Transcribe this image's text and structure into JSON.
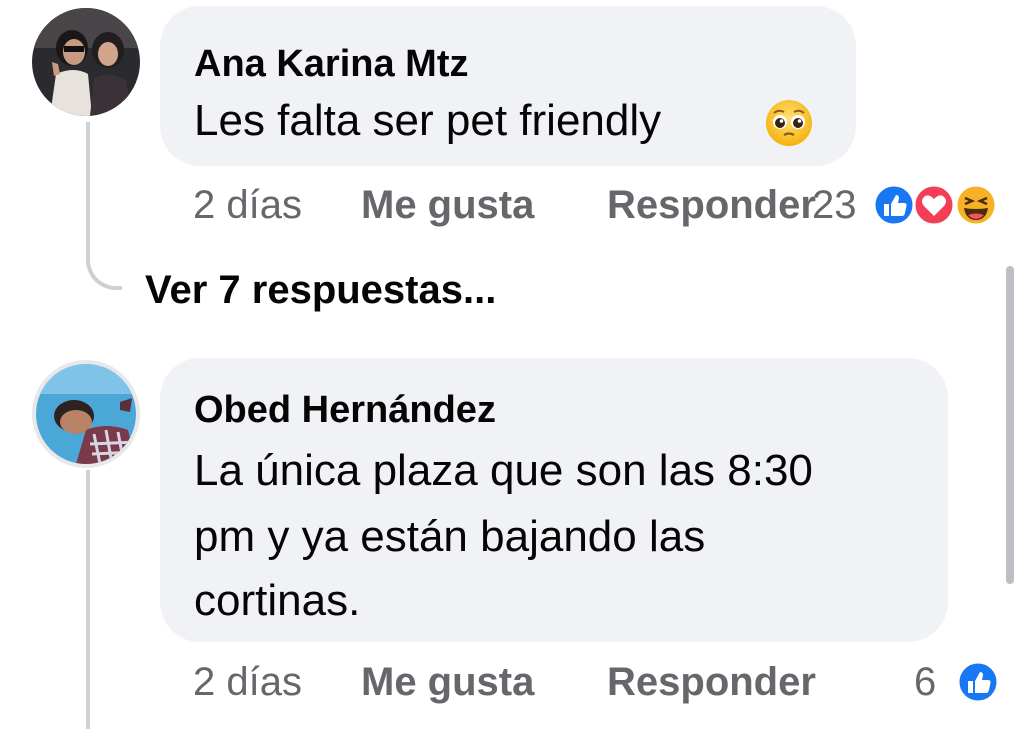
{
  "comments": [
    {
      "author": "Ana Karina Mtz",
      "text_lines": [
        "Les falta ser pet friendly"
      ],
      "emoji_icon": "pleading-face-emoji",
      "time": "2 días",
      "like_label": "Me gusta",
      "reply_label": "Responder",
      "reaction_count": "23",
      "reactions": [
        "like-reaction-icon",
        "love-reaction-icon",
        "haha-reaction-icon"
      ],
      "view_replies": "Ver 7 respuestas..."
    },
    {
      "author": "Obed Hernández",
      "text_lines": [
        "La única plaza que son las 8:30",
        "pm y ya están bajando las",
        "cortinas."
      ],
      "time": "2 días",
      "like_label": "Me gusta",
      "reply_label": "Responder",
      "reaction_count": "6",
      "reactions": [
        "like-reaction-icon"
      ]
    }
  ],
  "colors": {
    "bubble": "#f0f2f5",
    "meta_text": "#65676b",
    "like_blue": "#1877f2",
    "love_red": "#f33e58",
    "haha_yellow": "#f7b125",
    "thread_line": "#ced0d4"
  }
}
